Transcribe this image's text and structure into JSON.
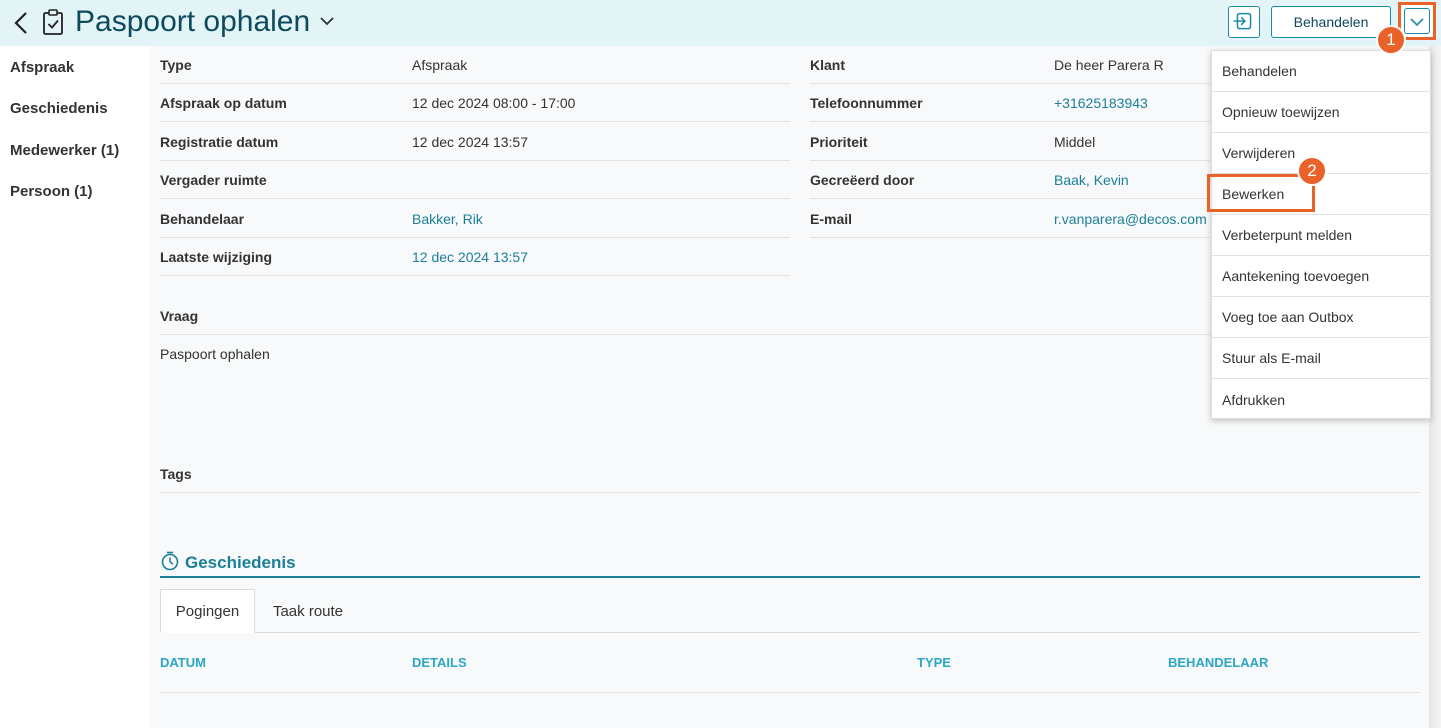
{
  "header": {
    "title": "Paspoort ophalen",
    "behandelen_label": "Behandelen",
    "accent_color": "#0d4a5e",
    "bg_color": "#e3f4f7"
  },
  "badges": {
    "one": "1",
    "two": "2"
  },
  "sidebar": {
    "items": [
      {
        "label": "Afspraak"
      },
      {
        "label": "Geschiedenis"
      },
      {
        "label": "Medewerker (1)"
      },
      {
        "label": "Persoon (1)"
      }
    ]
  },
  "details_left": [
    {
      "label": "Type",
      "value": "Afspraak"
    },
    {
      "label": "Afspraak op datum",
      "value": "12 dec 2024 08:00 - 17:00"
    },
    {
      "label": "Registratie datum",
      "value": "12 dec 2024 13:57"
    },
    {
      "label": "Vergader ruimte",
      "value": ""
    },
    {
      "label": "Behandelaar",
      "value": "Bakker, Rik"
    },
    {
      "label": "Laatste wijziging",
      "value": "12 dec 2024 13:57"
    }
  ],
  "details_right": [
    {
      "label": "Klant",
      "value": "De heer Parera R"
    },
    {
      "label": "Telefoonnummer",
      "value": "+31625183943"
    },
    {
      "label": "Prioriteit",
      "value": "Middel"
    },
    {
      "label": "Gecreëerd door",
      "value": "Baak, Kevin"
    },
    {
      "label": "E-mail",
      "value": "r.vanparera@decos.com"
    }
  ],
  "vraag": {
    "label": "Vraag",
    "value": "Paspoort ophalen"
  },
  "tags": {
    "label": "Tags"
  },
  "history": {
    "title": "Geschiedenis",
    "tabs": [
      {
        "label": "Pogingen"
      },
      {
        "label": "Taak route"
      }
    ],
    "columns": [
      "DATUM",
      "DETAILS",
      "TYPE",
      "BEHANDELAAR"
    ]
  },
  "menu": {
    "items": [
      {
        "label": "Behandelen"
      },
      {
        "label": "Opnieuw toewijzen"
      },
      {
        "label": "Verwijderen"
      },
      {
        "label": "Bewerken"
      },
      {
        "label": "Verbeterpunt melden"
      },
      {
        "label": "Aantekening toevoegen"
      },
      {
        "label": "Voeg toe aan Outbox"
      },
      {
        "label": "Stuur als E-mail"
      },
      {
        "label": "Afdrukken"
      }
    ]
  }
}
